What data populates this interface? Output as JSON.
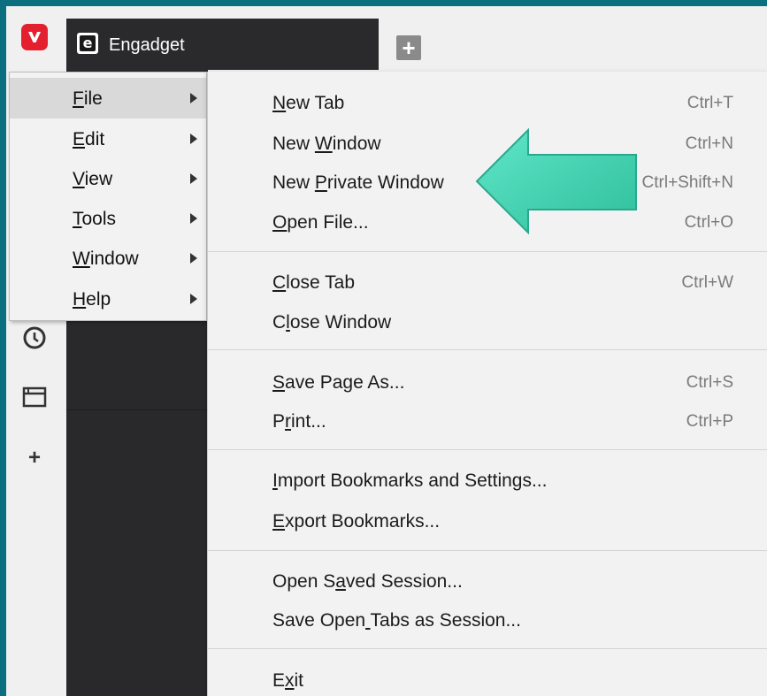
{
  "tab": {
    "favicon_letter": "e",
    "title": "Engadget"
  },
  "new_tab_symbol": "+",
  "side_panel": {
    "add_symbol": "+"
  },
  "main_menu": {
    "items": [
      {
        "label": "File",
        "accel": "F"
      },
      {
        "label": "Edit",
        "accel": "E"
      },
      {
        "label": "View",
        "accel": "V"
      },
      {
        "label": "Tools",
        "accel": "T"
      },
      {
        "label": "Window",
        "accel": "W"
      },
      {
        "label": "Help",
        "accel": "H"
      }
    ]
  },
  "file_menu": {
    "items": [
      {
        "label": "New Tab",
        "shortcut": "Ctrl+T"
      },
      {
        "label": "New Window",
        "shortcut": "Ctrl+N"
      },
      {
        "label": "New Private Window",
        "shortcut": "Ctrl+Shift+N"
      },
      {
        "label": "Open File...",
        "shortcut": "Ctrl+O"
      },
      {
        "label": "Close Tab",
        "shortcut": "Ctrl+W"
      },
      {
        "label": "Close Window",
        "shortcut": ""
      },
      {
        "label": "Save Page As...",
        "shortcut": "Ctrl+S"
      },
      {
        "label": "Print...",
        "shortcut": "Ctrl+P"
      },
      {
        "label": "Import Bookmarks and Settings...",
        "shortcut": ""
      },
      {
        "label": "Export Bookmarks...",
        "shortcut": ""
      },
      {
        "label": "Open Saved Session...",
        "shortcut": ""
      },
      {
        "label": "Save Open Tabs as Session...",
        "shortcut": ""
      },
      {
        "label": "Exit",
        "shortcut": ""
      }
    ]
  },
  "colors": {
    "frame": "#0b6f7f",
    "vivaldi_red": "#e5202e",
    "tab_dark": "#2a2a2c",
    "menu_bg": "#f2f2f2",
    "menu_active": "#d9d9d9",
    "arrow_fill": "#3fd6b4",
    "arrow_stroke": "#2aa88d"
  }
}
